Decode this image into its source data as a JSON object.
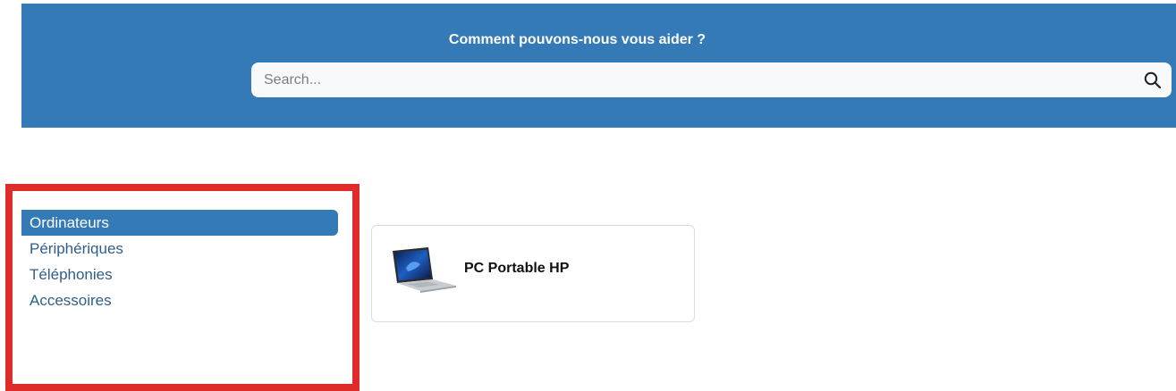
{
  "header": {
    "title": "Comment pouvons-nous vous aider ?",
    "search": {
      "placeholder": "Search...",
      "value": "",
      "icon": "search-icon"
    }
  },
  "sidebar": {
    "items": [
      {
        "label": "Ordinateurs",
        "active": true
      },
      {
        "label": "Périphériques",
        "active": false
      },
      {
        "label": "Téléphonies",
        "active": false
      },
      {
        "label": "Accessoires",
        "active": false
      }
    ]
  },
  "products": [
    {
      "name": "PC Portable HP",
      "image": "laptop-image"
    }
  ],
  "colors": {
    "primary": "#337ab7",
    "highlight_border": "#e02b2b",
    "link": "#2f5f88"
  }
}
